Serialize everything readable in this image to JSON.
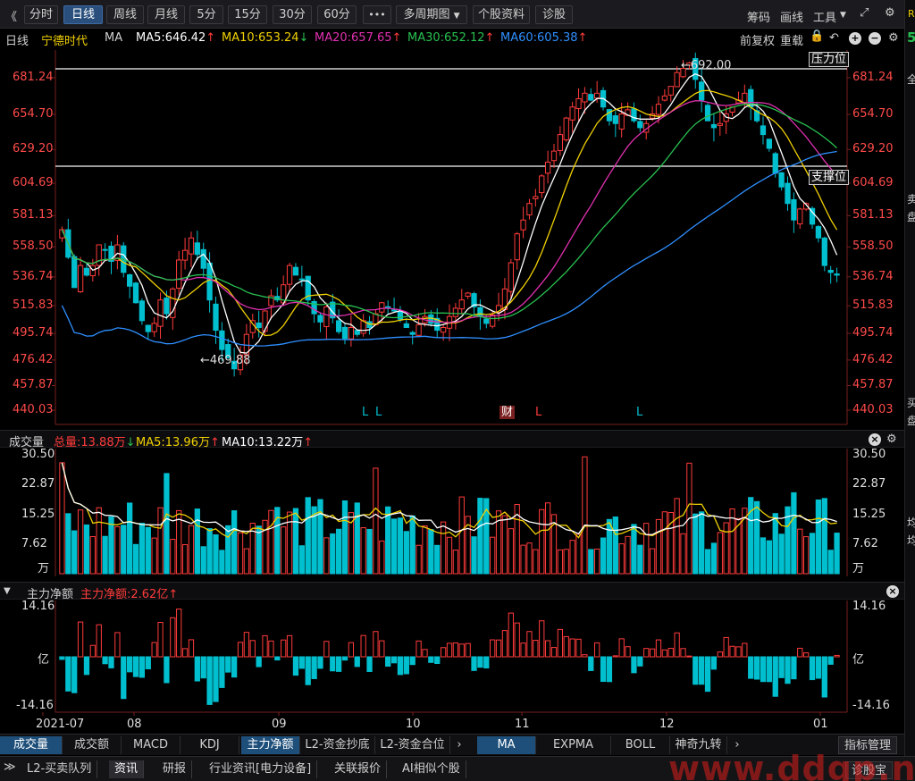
{
  "toolbar": {
    "back": "《",
    "periods": [
      "分时",
      "日线",
      "周线",
      "月线",
      "5分",
      "15分",
      "30分",
      "60分"
    ],
    "active_period": "日线",
    "more": "•••",
    "multi_period": "多周期图",
    "stock_info": "个股资料",
    "diagnose": "诊股",
    "chips": "筹码",
    "draw": "画线",
    "tools": "工具"
  },
  "infobar": {
    "period": "日线",
    "stock_name": "宁德时代",
    "indicator": "MA",
    "ma5": "MA5:646.42",
    "ma10": "MA10:653.24",
    "ma20": "MA20:657.65",
    "ma30": "MA30:652.12",
    "ma60": "MA60:605.38",
    "adjust": "前复权",
    "reset": "重载"
  },
  "colors": {
    "up": "#ff3b3b",
    "down": "#00c0d0",
    "ma5": "#ffffff",
    "ma10": "#f0d000",
    "ma20": "#e030b0",
    "ma30": "#28c050",
    "ma60": "#2f8fff",
    "axis_red": "#ff4a4a",
    "panel_bg": "#000000"
  },
  "price_panel": {
    "y_ticks": [
      "681.24",
      "654.70",
      "629.20",
      "604.69",
      "581.13",
      "558.50",
      "536.74",
      "515.83",
      "495.74",
      "476.42",
      "457.87",
      "440.03"
    ],
    "resistance_label": "压力位",
    "support_label": "支撑位",
    "high_marker": "←692.00",
    "low_marker": "←469.88",
    "markers": [
      "L",
      "L",
      "财",
      "L",
      "L"
    ]
  },
  "volume_panel": {
    "title": "成交量",
    "total": "总量:13.88万",
    "ma5": "MA5:13.96万",
    "ma10": "MA10:13.22万",
    "y_ticks": [
      "30.50",
      "22.87",
      "15.25",
      "7.62"
    ],
    "unit": "万"
  },
  "flow_panel": {
    "title": "主力净额",
    "value": "主力净额:2.62亿",
    "y_top": "14.16",
    "y_mid": "亿",
    "y_bottom": "-14.16"
  },
  "x_axis": [
    "2021-07",
    "08",
    "09",
    "10",
    "11",
    "12",
    "01"
  ],
  "bottom_tabs_left": [
    "成交量",
    "成交额",
    "MACD",
    "KDJ",
    "主力净额",
    "L2-资金抄底",
    "L2-资金合位"
  ],
  "bottom_tabs_right": [
    "MA",
    "EXPMA",
    "BOLL",
    "神奇九转"
  ],
  "indicator_manage": "指标管理",
  "info_tabs": [
    "L2-买卖队列",
    "资讯",
    "研报",
    "行业资讯[电力设备]",
    "关联报价",
    "AI相似个股"
  ],
  "diagnose_btn": "诊股宝",
  "watermark": "www.ddgp.net",
  "right_edge": [
    "R",
    "5",
    "全",
    "卖",
    "盘",
    "买",
    "盘",
    "均",
    "均"
  ],
  "chart_data": {
    "type": "candlestick",
    "title": "宁德时代 日线",
    "x_range": [
      "2021-07",
      "2022-01"
    ],
    "ylim": [
      440.03,
      692.0
    ],
    "key_levels": {
      "resistance": 692.0,
      "support": 604.69,
      "high": 692.0,
      "low": 469.88
    },
    "close_series": [
      571,
      551,
      529,
      545,
      538,
      545,
      560,
      556,
      548,
      560,
      540,
      530,
      518,
      505,
      497,
      503,
      520,
      510,
      528,
      549,
      556,
      565,
      553,
      543,
      520,
      498,
      484,
      478,
      470,
      480,
      495,
      505,
      500,
      512,
      523,
      520,
      531,
      545,
      538,
      535,
      520,
      510,
      504,
      515,
      507,
      497,
      492,
      500,
      495,
      505,
      500,
      510,
      518,
      515,
      512,
      506,
      500,
      495,
      502,
      508,
      503,
      498,
      500,
      508,
      514,
      520,
      525,
      515,
      508,
      503,
      509,
      516,
      528,
      547,
      568,
      578,
      590,
      595,
      610,
      620,
      628,
      640,
      652,
      660,
      666,
      670,
      665,
      670,
      660,
      650,
      648,
      655,
      658,
      650,
      645,
      648,
      655,
      662,
      668,
      675,
      685,
      688,
      692,
      680,
      665,
      650,
      645,
      648,
      655,
      660,
      665,
      670,
      660,
      650,
      640,
      630,
      612,
      602,
      590,
      578,
      586,
      590,
      575,
      565,
      545,
      540,
      538
    ]
  }
}
